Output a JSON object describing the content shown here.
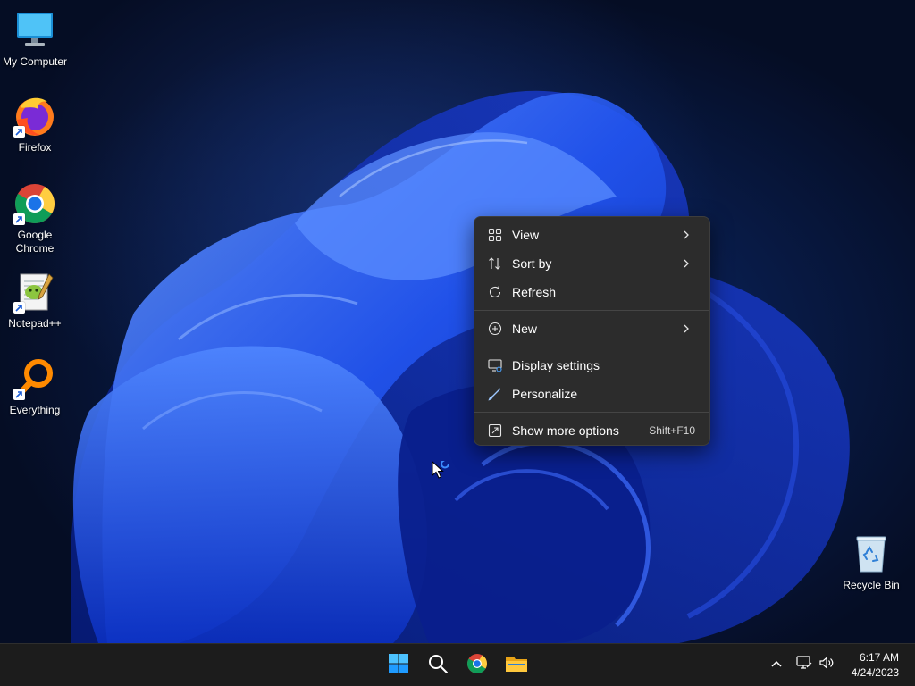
{
  "desktop": {
    "icons": [
      {
        "label": "My Computer",
        "icon": "monitor-icon"
      },
      {
        "label": "Firefox",
        "icon": "firefox-icon"
      },
      {
        "label": "Google Chrome",
        "icon": "chrome-icon"
      },
      {
        "label": "Notepad++",
        "icon": "notepadpp-icon"
      },
      {
        "label": "Everything",
        "icon": "everything-search-icon"
      }
    ],
    "recycle_bin": {
      "label": "Recycle Bin",
      "icon": "recycle-bin-icon"
    }
  },
  "context_menu": {
    "view": {
      "label": "View",
      "icon": "grid-view-icon"
    },
    "sort_by": {
      "label": "Sort by",
      "icon": "sort-icon"
    },
    "refresh": {
      "label": "Refresh",
      "icon": "refresh-icon"
    },
    "new": {
      "label": "New",
      "icon": "plus-circle-icon"
    },
    "display_settings": {
      "label": "Display settings",
      "icon": "display-settings-icon"
    },
    "personalize": {
      "label": "Personalize",
      "icon": "brush-icon"
    },
    "show_more": {
      "label": "Show more options",
      "shortcut": "Shift+F10",
      "icon": "show-more-icon"
    }
  },
  "taskbar": {
    "pinned": [
      "start-icon",
      "search-icon",
      "chrome-icon",
      "file-explorer-icon"
    ],
    "tray": [
      "chevron-up-icon",
      "network-icon",
      "volume-icon"
    ],
    "clock": {
      "time": "6:17 AM",
      "date": "4/24/2023"
    }
  },
  "colors": {
    "menu_background": "#2c2c2c",
    "taskbar_background": "#1c1c1c",
    "accent": "#1e6fff"
  }
}
